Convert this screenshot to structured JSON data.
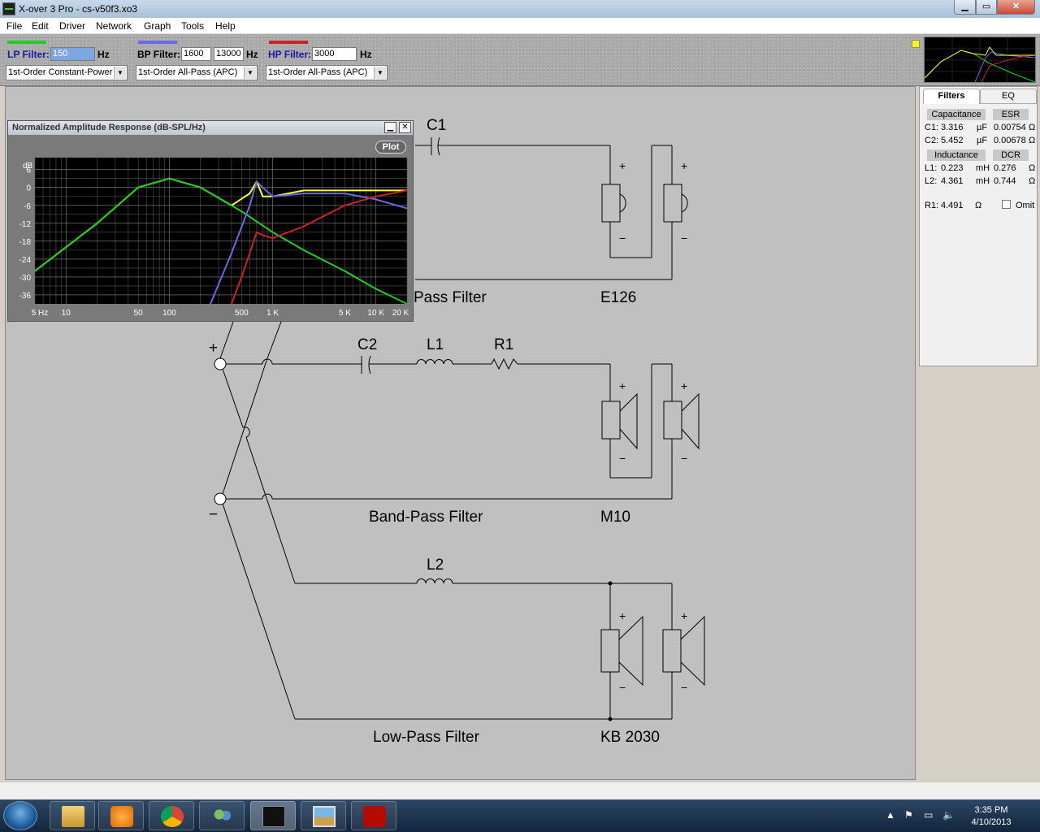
{
  "window": {
    "title": "X-over 3 Pro  -  cs-v50f3.xo3",
    "min": "▁",
    "max": "▭",
    "close": "✕"
  },
  "menu": [
    "File",
    "Edit",
    "Driver",
    "Network",
    "Graph",
    "Tools",
    "Help"
  ],
  "toolbar": {
    "lp": {
      "label": "LP Filter:",
      "value": "150",
      "unit": "Hz",
      "color": "#22cc22",
      "type": "1st-Order Constant-Power"
    },
    "bp": {
      "label": "BP Filter:",
      "low": "1600",
      "high": "13000",
      "unit": "Hz",
      "color": "#6a6ae8",
      "type": "1st-Order All-Pass (APC)"
    },
    "hp": {
      "label": "HP Filter:",
      "value": "3000",
      "unit": "Hz",
      "color": "#cc2222",
      "type": "1st-Order All-Pass (APC)"
    }
  },
  "right_panel": {
    "tabs": [
      "Filters",
      "EQ"
    ],
    "cap_header": "Capacitance",
    "esr_header": "ESR",
    "caps": [
      {
        "name": "C1:",
        "value": "3.316",
        "unit": "µF",
        "esr": "0.00754",
        "esr_unit": "Ω"
      },
      {
        "name": "C2:",
        "value": "5.452",
        "unit": "µF",
        "esr": "0.00678",
        "esr_unit": "Ω"
      }
    ],
    "ind_header": "Inductance",
    "dcr_header": "DCR",
    "inds": [
      {
        "name": "L1:",
        "value": "0.223",
        "unit": "mH",
        "dcr": "0.276",
        "dcr_unit": "Ω"
      },
      {
        "name": "L2:",
        "value": "4.361",
        "unit": "mH",
        "dcr": "0.744",
        "dcr_unit": "Ω"
      }
    ],
    "r1": {
      "name": "R1:",
      "value": "4.491",
      "unit": "Ω",
      "omit": "Omit"
    }
  },
  "schematic": {
    "hp_label": "Pass Filter",
    "hp_driver": "E126",
    "bp_label": "Band-Pass Filter",
    "bp_driver": "M10",
    "lp_label": "Low-Pass Filter",
    "lp_driver": "KB 2030",
    "parts": {
      "c1": "C1",
      "c2": "C2",
      "l1": "L1",
      "r1": "R1",
      "l2": "L2"
    },
    "plus": "+",
    "minus": "−"
  },
  "plot_window": {
    "title": "Normalized Amplitude Response (dB-SPL/Hz)",
    "button": "Plot",
    "min": "▁",
    "close": "✕",
    "y_unit": "dB",
    "y_ticks": [
      "6",
      "0",
      "-6",
      "-12",
      "-18",
      "-24",
      "-30",
      "-36"
    ],
    "x_ticks": [
      "5 Hz",
      "10",
      "50",
      "100",
      "500",
      "1 K",
      "5 K",
      "10 K",
      "20 K"
    ]
  },
  "chart_data": {
    "type": "line",
    "title": "Normalized Amplitude Response (dB-SPL/Hz)",
    "xlabel": "",
    "ylabel": "dB",
    "x_scale": "log",
    "xlim": [
      5,
      20000
    ],
    "ylim": [
      -39,
      10
    ],
    "grid": true,
    "series": [
      {
        "color": "#ffff33",
        "x": [
          5,
          10,
          20,
          50,
          100,
          200,
          400,
          600,
          700,
          800,
          1000,
          2000,
          5000,
          10000,
          20000
        ],
        "y": [
          -28,
          -20,
          -12,
          0,
          3,
          0,
          -6,
          -2,
          2,
          -3,
          -3,
          -1,
          -1,
          -1,
          -1
        ]
      },
      {
        "color": "#22cc22",
        "x": [
          5,
          10,
          20,
          50,
          100,
          200,
          500,
          1000,
          2000,
          5000,
          10000,
          20000
        ],
        "y": [
          -28,
          -20,
          -12,
          0,
          3,
          0,
          -8,
          -15,
          -21,
          -28,
          -34,
          -39
        ]
      },
      {
        "color": "#6a6ae8",
        "x": [
          250,
          400,
          600,
          700,
          800,
          1000,
          2000,
          5000,
          10000,
          20000
        ],
        "y": [
          -39,
          -22,
          -6,
          2,
          0,
          -3,
          -2,
          -2,
          -4,
          -7
        ]
      },
      {
        "color": "#cc2222",
        "x": [
          400,
          500,
          600,
          700,
          800,
          1000,
          2000,
          5000,
          10000,
          20000
        ],
        "y": [
          -39,
          -30,
          -22,
          -15,
          -16,
          -17,
          -13,
          -6,
          -3,
          -1
        ]
      }
    ]
  },
  "status": {
    "text": ""
  },
  "taskbar": {
    "time": "3:35 PM",
    "date": "4/10/2013",
    "apps": [
      "explorer",
      "media-player",
      "chrome",
      "network-users",
      "xover3",
      "photo-viewer",
      "acrobat"
    ]
  }
}
